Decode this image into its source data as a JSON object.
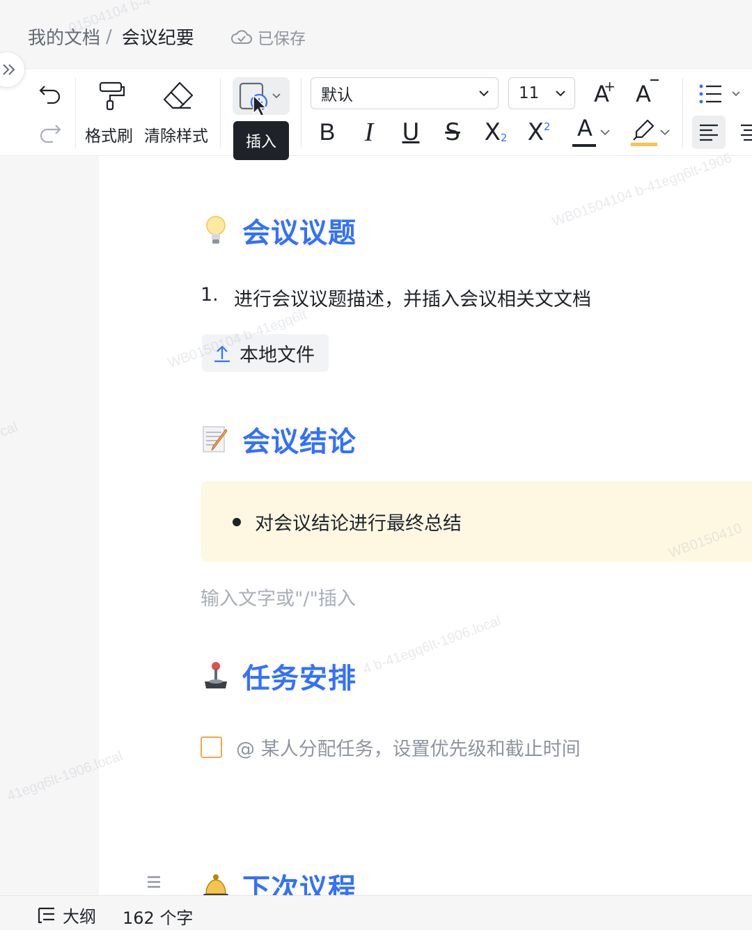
{
  "breadcrumb": {
    "parent": "我的文档",
    "separator": "/",
    "current": "会议纪要"
  },
  "save_status": "已保存",
  "toolbar": {
    "format_painter_label": "格式刷",
    "clear_style_label": "清除样式",
    "insert_tooltip": "插入",
    "font_style": "默认",
    "font_size": "11",
    "bold": "B",
    "italic": "I",
    "underline": "U",
    "strike": "S",
    "subscript": "X",
    "subscript_mark": "2",
    "superscript": "X",
    "superscript_mark": "2",
    "font_color": "A",
    "font_increase": "A",
    "font_decrease": "A"
  },
  "document": {
    "section1": {
      "title": "会议议题",
      "emoji": "lightbulb"
    },
    "list_number": "1.",
    "list_item": "进行会议议题描述，并插入会议相关文文档",
    "file_chip": "本地文件",
    "section2": {
      "title": "会议结论",
      "emoji": "memo"
    },
    "bullet": "对会议结论进行最终总结",
    "placeholder": "输入文字或\"/\"插入",
    "section3": {
      "title": "任务安排",
      "emoji": "joystick"
    },
    "todo": "@ 某人分配任务，设置优先级和截止时间",
    "section4": {
      "title": "下次议程",
      "emoji": "bell"
    }
  },
  "statusbar": {
    "outline": "大纲",
    "word_count": "162 个字"
  },
  "watermark": [
    "01504104 b-4",
    "WB01504104 b-41egq6lt-1906",
    "WB0150104 b-41egq6lt",
    "4 b-41egq6lt-1906.local",
    "WB0150410",
    "41egq6lt-1906.local",
    "cal"
  ],
  "colors": {
    "accent": "#3370ff",
    "callout_bg": "#fef8e3",
    "checkbox": "#f5a64a",
    "highlight": "#f5c451",
    "tooltip_bg": "#1f2329"
  }
}
